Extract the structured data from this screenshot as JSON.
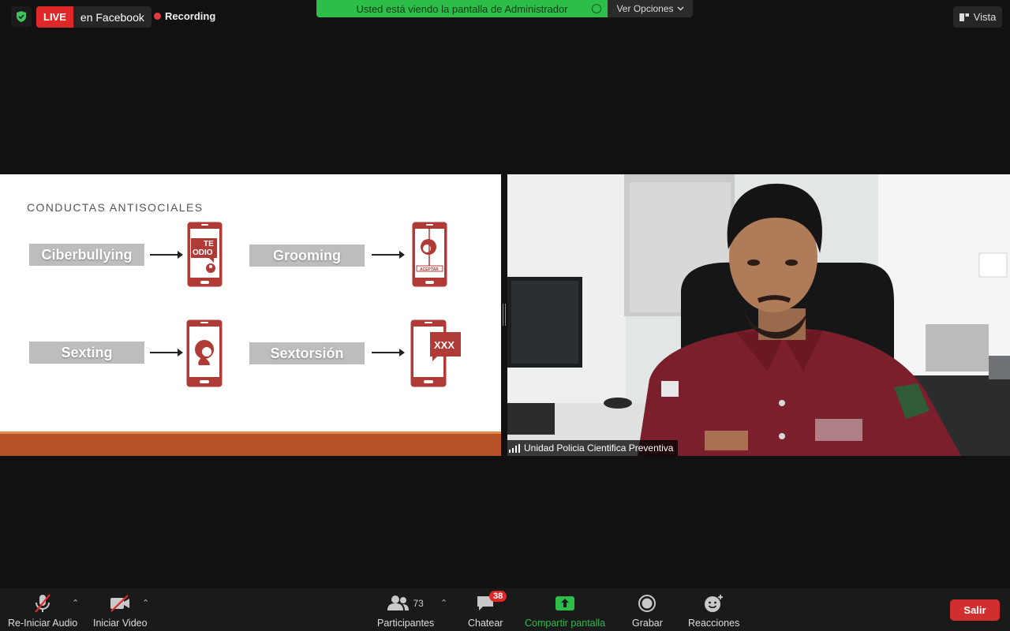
{
  "top_bar": {
    "live_badge": "LIVE",
    "live_platform": "en Facebook",
    "recording_label": "Recording",
    "viewing_banner": "Usted está viendo la pantalla de Administrador",
    "view_options": "Ver Opciones",
    "view_button": "Vista"
  },
  "slide": {
    "title": "CONDUCTAS ANTISOCIALES",
    "items": [
      {
        "label": "Ciberbullying",
        "icon": "phone-hate-message-icon",
        "icon_text": "TE ODIO"
      },
      {
        "label": "Grooming",
        "icon": "phone-accept-request-icon",
        "icon_text": "ACEPTAR"
      },
      {
        "label": "Sexting",
        "icon": "phone-profile-icon"
      },
      {
        "label": "Sextorsión",
        "icon": "phone-xxx-icon",
        "icon_text": "XXX"
      }
    ],
    "colors": {
      "accent": "#b03a36",
      "label_bg": "#bdbdbd",
      "footer": "#b55127"
    }
  },
  "video": {
    "participant_name": "Unidad Policia Cientifica Preventiva"
  },
  "toolbar": {
    "audio": "Re-Iniciar Audio",
    "video": "Iniciar Video",
    "participants": "Participantes",
    "participants_count": "73",
    "chat": "Chatear",
    "chat_badge": "38",
    "share": "Compartir pantalla",
    "record": "Grabar",
    "reactions": "Reacciones",
    "exit": "Salir",
    "share_color": "#2dbd49",
    "exit_color": "#d12f2f"
  }
}
